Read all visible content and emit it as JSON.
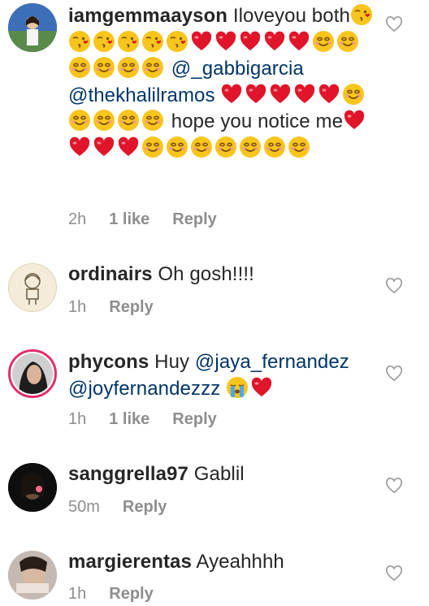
{
  "comments": [
    {
      "username": "iamgemmaayson",
      "segments": [
        {
          "t": "text",
          "v": "Iloveyou both"
        },
        {
          "t": "emoji",
          "v": "kiss-face",
          "n": 6
        },
        {
          "t": "emoji",
          "v": "heart",
          "n": 5
        },
        {
          "t": "emoji",
          "v": "smile",
          "n": 6
        },
        {
          "t": "text",
          "v": " "
        },
        {
          "t": "mention",
          "v": "@_gabbigarcia"
        },
        {
          "t": "text",
          "v": " "
        },
        {
          "t": "mention",
          "v": "@thekhalilramos"
        },
        {
          "t": "text",
          "v": " "
        },
        {
          "t": "emoji",
          "v": "heart",
          "n": 5
        },
        {
          "t": "emoji",
          "v": "smile",
          "n": 5
        },
        {
          "t": "text",
          "v": " hope you notice me"
        },
        {
          "t": "emoji",
          "v": "heart",
          "n": 4
        },
        {
          "t": "emoji",
          "v": "smile",
          "n": 7
        }
      ],
      "time": "2h",
      "likes": "1 like",
      "reply": "Reply",
      "avatar": "avatar-gemma"
    },
    {
      "username": "ordinairs",
      "segments": [
        {
          "t": "text",
          "v": "Oh gosh!!!!"
        }
      ],
      "time": "1h",
      "likes": "",
      "reply": "Reply",
      "avatar": "avatar-ordinairs"
    },
    {
      "username": "phycons",
      "segments": [
        {
          "t": "text",
          "v": "Huy "
        },
        {
          "t": "mention",
          "v": "@jaya_fernandez"
        },
        {
          "t": "text",
          "v": " "
        },
        {
          "t": "mention",
          "v": "@joyfernandezzz"
        },
        {
          "t": "text",
          "v": " "
        },
        {
          "t": "emoji",
          "v": "crying-face",
          "n": 1
        },
        {
          "t": "emoji",
          "v": "heart",
          "n": 1
        }
      ],
      "time": "1h",
      "likes": "1 like",
      "reply": "Reply",
      "avatar": "avatar-phycons"
    },
    {
      "username": "sanggrella97",
      "segments": [
        {
          "t": "text",
          "v": "Gablil"
        }
      ],
      "time": "50m",
      "likes": "",
      "reply": "Reply",
      "avatar": "avatar-sanggrella"
    },
    {
      "username": "margierentas",
      "segments": [
        {
          "t": "text",
          "v": "Ayeahhhh"
        }
      ],
      "time": "1h",
      "likes": "",
      "reply": "Reply",
      "avatar": "avatar-margie"
    }
  ],
  "colors": {
    "mention": "#003569",
    "meta": "#8e8e8e",
    "text": "#262626"
  }
}
